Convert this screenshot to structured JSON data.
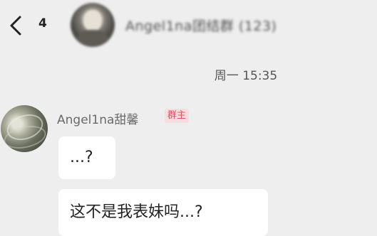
{
  "header": {
    "unread_count": "4",
    "group_title": "Angel1na团结群 (123)"
  },
  "chat": {
    "timestamp": "周一 15:35",
    "messages": [
      {
        "sender": "Angel1na甜馨",
        "role_badge": "群主",
        "bubbles": [
          "...?",
          "这不是我表妹吗...?"
        ]
      }
    ]
  },
  "colors": {
    "background": "#eeeeee",
    "bubble": "#ffffff",
    "badge_text": "#e0505e",
    "badge_bg": "#f6dde0"
  },
  "icons": {
    "back": "chevron-left-icon"
  }
}
